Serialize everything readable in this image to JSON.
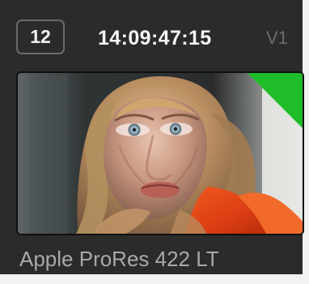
{
  "clip": {
    "number": "12",
    "timecode": "14:09:47:15",
    "track": "V1",
    "codec": "Apple ProRes 422 LT",
    "flag": {
      "color": "#1fbd29",
      "icon": "person-icon"
    },
    "thumbnail": {
      "description_icon": "face-thumbnail"
    }
  }
}
